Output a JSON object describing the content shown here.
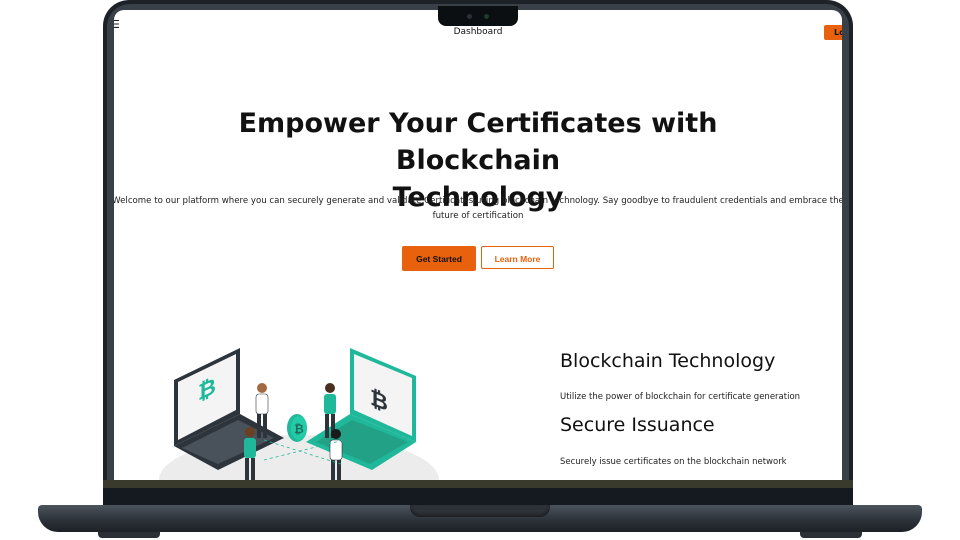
{
  "nav": {
    "title": "Dashboard",
    "login_label": "Lo"
  },
  "hero": {
    "title_line1": "Empower Your Certificates with Blockchain",
    "title_line2": "Technology",
    "description_line1": "Welcome to our platform where you can securely generate and validate Certificates using blockchain technology. Say goodbye to fraudulent credentials and embrace the",
    "description_line2": "future of certification",
    "primary_button": "Get Started",
    "secondary_button": "Learn More"
  },
  "features": [
    {
      "title": "Blockchain Technology",
      "description": "Utilize the power of blockchain for certificate generation"
    },
    {
      "title": "Secure Issuance",
      "description": "Securely issue certificates on the blockchain network"
    }
  ],
  "colors": {
    "accent": "#e8610d",
    "illustration_teal": "#1fb89a",
    "laptop_dark": "#1c2228"
  },
  "icons": {
    "menu": "hamburger-icon",
    "illustration": "blockchain-people-laptops-illustration"
  }
}
